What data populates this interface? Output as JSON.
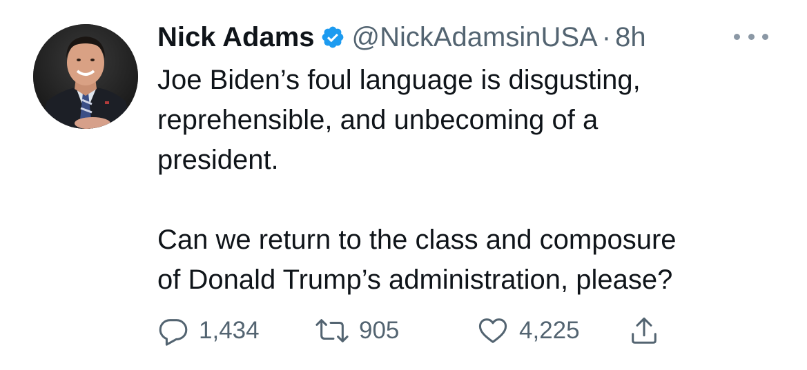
{
  "tweet": {
    "author_name": "Nick Adams",
    "handle": "@NickAdamsinUSA",
    "separator": "·",
    "time": "8h",
    "verified_icon": "verified-badge-icon",
    "more_icon": "more-dots-icon",
    "text_paragraph_1": [
      "Joe Biden’s foul language is disgusting,",
      "reprehensible, and unbecoming of a",
      "president."
    ],
    "text_paragraph_2": [
      "Can we return to the class and composure",
      "of Donald Trump’s administration, please?"
    ],
    "actions": {
      "reply_count": "1,434",
      "retweet_count": "905",
      "like_count": "4,225",
      "reply_icon": "reply-icon",
      "retweet_icon": "retweet-icon",
      "like_icon": "heart-icon",
      "share_icon": "share-icon"
    },
    "colors": {
      "text": "#0f1419",
      "secondary": "#536471",
      "verified": "#1d9bf0"
    }
  }
}
